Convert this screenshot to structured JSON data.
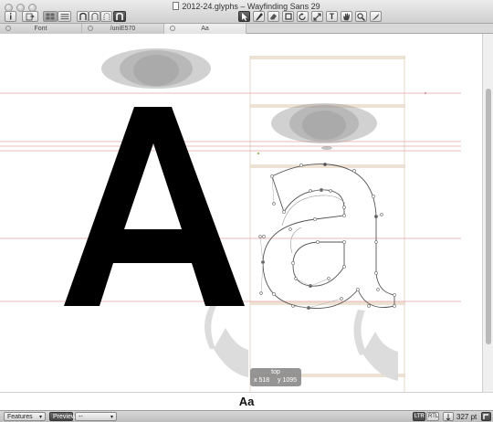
{
  "window": {
    "title": "2012-24.glyphs – Wayfinding Sans 29"
  },
  "tabs": [
    {
      "label": "Font"
    },
    {
      "label": "/uniE570"
    },
    {
      "label": "Aa"
    }
  ],
  "toolbar": {
    "text_tool_label": "T",
    "tools": [
      "select-tool",
      "draw-tool",
      "eraser-tool",
      "rectangle-tool",
      "rotate-tool",
      "scale-tool",
      "text-tool",
      "hand-tool",
      "zoom-tool",
      "knife-tool"
    ]
  },
  "editor": {
    "glyphs": [
      "A",
      "a"
    ],
    "readout": {
      "title": "top",
      "x": "x 518",
      "y": "y 1095"
    }
  },
  "preview": {
    "text": "Aa"
  },
  "statusbar": {
    "features_label": "Features",
    "preview_label": "Preview",
    "instance_label": "--",
    "ltr_label": "LTR",
    "rtl_label": "RTL",
    "zoom": "327 pt"
  },
  "colors": {
    "guide_red": "#e7a0a0",
    "metric_beige": "#e9dccb",
    "outline_gray": "#666666",
    "fill_black": "#000000"
  }
}
